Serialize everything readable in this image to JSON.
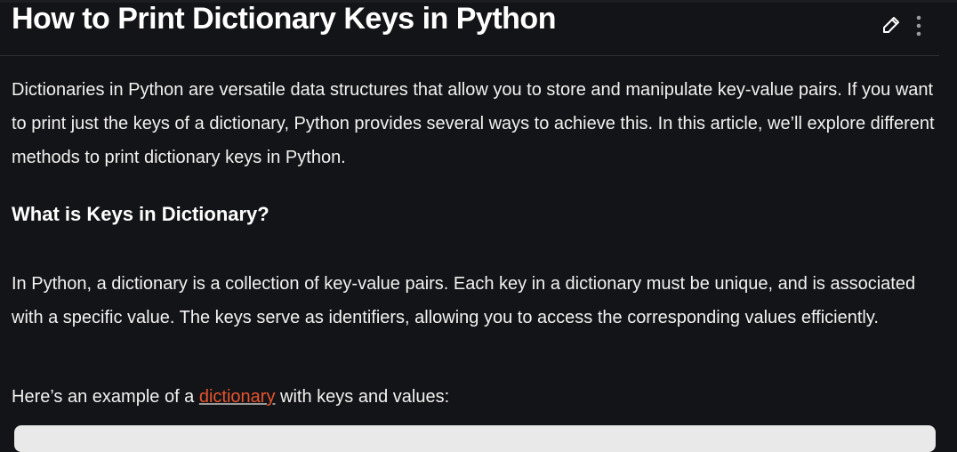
{
  "article": {
    "title": "How to Print Dictionary Keys in Python",
    "intro": "Dictionaries in Python are versatile data structures that allow you to store and manipulate key-value pairs. If you want to print just the keys of a dictionary, Python provides several ways to achieve this. In this article, we’ll explore different methods to print dictionary keys in Python.",
    "heading": "What is Keys in Dictionary?",
    "para2": "In Python, a dictionary is a collection of key-value pairs. Each key in a dictionary must be unique, and is associated with a specific value. The keys serve as identifiers, allowing you to access the corresponding values efficiently.",
    "para3_before": "Here’s an example of a ",
    "para3_link": "dictionary",
    "para3_after": " with keys and values:"
  },
  "icons": {
    "edit": "pencil-icon",
    "more": "more-vertical-icon"
  }
}
